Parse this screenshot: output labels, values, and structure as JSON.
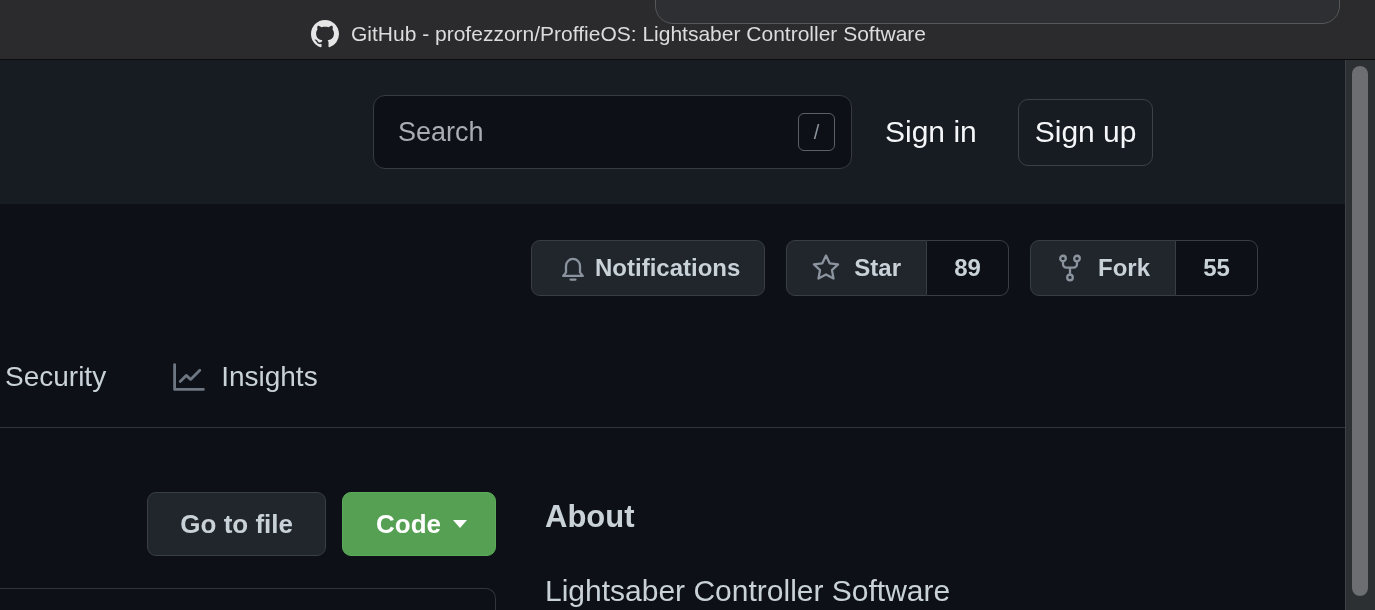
{
  "window": {
    "title": "GitHub - profezzorn/ProffieOS: Lightsaber Controller Software"
  },
  "header": {
    "search": {
      "placeholder": "Search",
      "shortcut": "/"
    },
    "sign_in": "Sign in",
    "sign_up": "Sign up"
  },
  "repo_actions": [
    {
      "kind": "notifications",
      "label": "Notifications"
    },
    {
      "kind": "star",
      "label": "Star",
      "count": "89"
    },
    {
      "kind": "fork",
      "label": "Fork",
      "count": "55"
    }
  ],
  "tabs": [
    {
      "kind": "text",
      "label": "Security",
      "selected": false
    },
    {
      "kind": "graph",
      "label": "Insights",
      "selected": false
    }
  ],
  "file_buttons": [
    {
      "kind": "secondary",
      "label": "Go to file",
      "dropdown": false
    },
    {
      "kind": "primary",
      "label": "Code",
      "dropdown": true
    }
  ],
  "about": {
    "heading": "About",
    "description": "Lightsaber Controller Software"
  }
}
